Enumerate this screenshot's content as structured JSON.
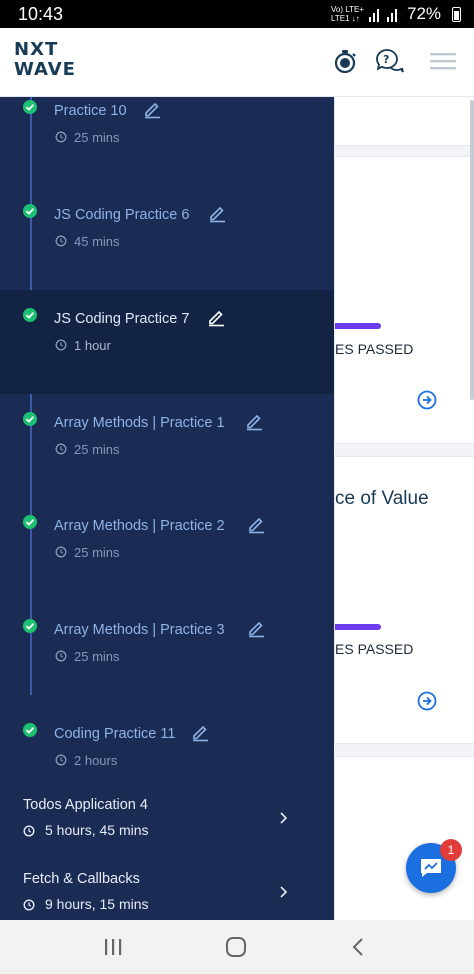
{
  "status_bar": {
    "time": "10:43",
    "network_line1": "Vo) LTE+",
    "network_line2": "LTE1 ↓↑",
    "battery": "72%"
  },
  "app_bar": {
    "logo_line1": "NXT",
    "logo_line2": "WAVE",
    "icons": [
      "stopwatch-icon",
      "help-chat-icon",
      "hamburger-menu-icon"
    ]
  },
  "background_cards": [
    {
      "passed_text": "ES PASSED",
      "arrow_icon": "arrow-right-circle-icon"
    },
    {
      "title_fragment": "ce of Value",
      "passed_text": "ES PASSED",
      "arrow_icon": "arrow-right-circle-icon"
    }
  ],
  "drawer": {
    "items": [
      {
        "label": "Practice 10",
        "duration": "25 mins",
        "completed": true,
        "active": false
      },
      {
        "label": "JS Coding Practice 6",
        "duration": "45 mins",
        "completed": true,
        "active": false
      },
      {
        "label": "JS Coding Practice 7",
        "duration": "1 hour",
        "completed": true,
        "active": true
      },
      {
        "label": "Array Methods | Practice 1",
        "duration": "25 mins",
        "completed": true,
        "active": false
      },
      {
        "label": "Array Methods | Practice 2",
        "duration": "25 mins",
        "completed": true,
        "active": false
      },
      {
        "label": "Array Methods | Practice 3",
        "duration": "25 mins",
        "completed": true,
        "active": false
      },
      {
        "label": "Coding Practice 11",
        "duration": "2 hours",
        "completed": true,
        "active": false
      }
    ],
    "topics": [
      {
        "name": "Todos Application 4",
        "duration": "5 hours, 45 mins"
      },
      {
        "name": "Fetch & Callbacks",
        "duration": "9 hours, 15 mins"
      }
    ]
  },
  "chat": {
    "badge_count": "1"
  },
  "colors": {
    "drawer_bg": "#1b2c54",
    "active_item_bg": "#132343",
    "check_green": "#1dbf73",
    "brand_blue": "#183b56",
    "progress_purple": "#6b3cf2",
    "chat_blue": "#1b6fe0",
    "badge_red": "#e23b3b"
  }
}
